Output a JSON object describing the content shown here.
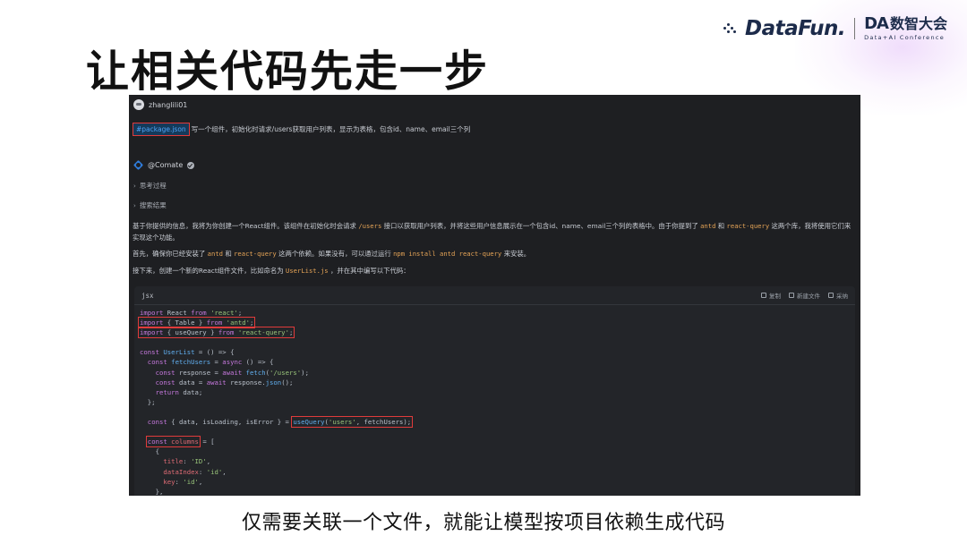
{
  "slide": {
    "title": "让相关代码先走一步",
    "caption": "仅需要关联一个文件，就能让模型按项目依赖生成代码"
  },
  "brand": {
    "datafun": "DataFun.",
    "da_mark": "DA",
    "da_cn": "数智大会",
    "da_en": "Data+AI Conference"
  },
  "chat": {
    "user_name": "zhanglili01",
    "prompt_tag": "#package.json",
    "prompt_text": "写一个组件，初始化时请求/users获取用户列表，显示为表格，包含id、name、email三个列",
    "bot_name": "@Comate",
    "thinking_label": "思考过程",
    "search_label": "搜索结果",
    "para1_a": "基于你提供的信息，我将为你创建一个React组件。该组件在初始化时会请求",
    "para1_code1": "/users",
    "para1_b": "接口以获取用户列表，并将这些用户信息展示在一个包含id、name、email三个列的表格中。由于你提到了",
    "para1_code2": "antd",
    "para1_c": "和",
    "para1_code3": "react-query",
    "para1_d": "这两个库，我将使用它们来实现这个功能。",
    "para2_a": "首先，确保你已经安装了",
    "para2_code1": "antd",
    "para2_b": "和",
    "para2_code2": "react-query",
    "para2_c": "这两个依赖。如果没有，可以通过运行",
    "para2_code3": "npm install antd react-query",
    "para2_d": "来安装。",
    "para3_a": "接下来，创建一个新的React组件文件，比如命名为",
    "para3_code1": "UserList.js",
    "para3_b": "，并在其中编写以下代码："
  },
  "code_block": {
    "lang": "jsx",
    "action_copy": "复制",
    "action_new_file": "新建文件",
    "action_accept": "采纳",
    "lines": [
      "import React from 'react';",
      "import { Table } from 'antd';",
      "import { useQuery } from 'react-query';",
      "",
      "const UserList = () => {",
      "  const fetchUsers = async () => {",
      "    const response = await fetch('/users');",
      "    const data = await response.json();",
      "    return data;",
      "  };",
      "",
      "  const { data, isLoading, isError } = useQuery('users', fetchUsers);",
      "",
      "  const columns = [",
      "    {",
      "      title: 'ID',",
      "      dataIndex: 'id',",
      "      key: 'id',",
      "    },"
    ]
  }
}
